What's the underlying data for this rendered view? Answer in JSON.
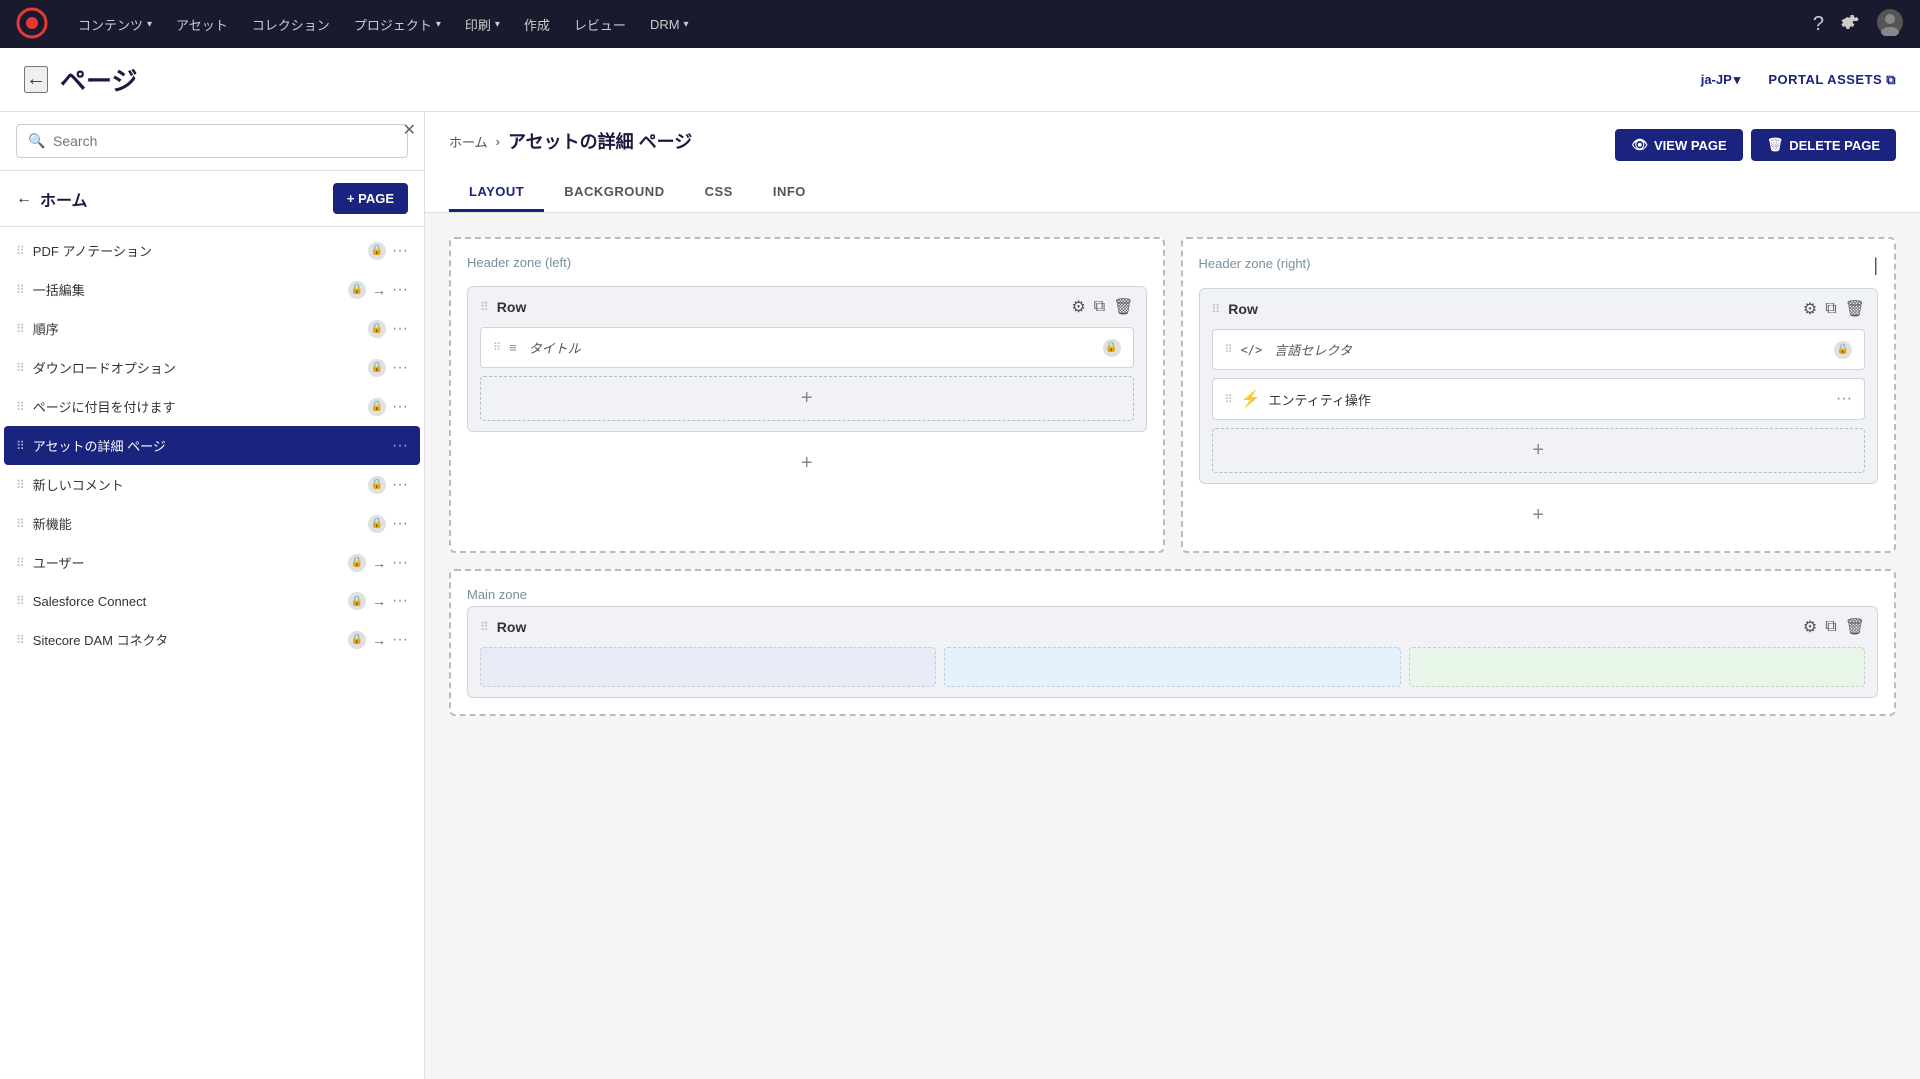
{
  "app": {
    "logo_color": "#e53935"
  },
  "topnav": {
    "items": [
      {
        "id": "contents",
        "label": "コンテンツ",
        "has_dropdown": true
      },
      {
        "id": "assets",
        "label": "アセット",
        "has_dropdown": false
      },
      {
        "id": "collections",
        "label": "コレクション",
        "has_dropdown": false
      },
      {
        "id": "projects",
        "label": "プロジェクト",
        "has_dropdown": true
      },
      {
        "id": "print",
        "label": "印刷",
        "has_dropdown": true
      },
      {
        "id": "create",
        "label": "作成",
        "has_dropdown": false
      },
      {
        "id": "review",
        "label": "レビュー",
        "has_dropdown": false
      },
      {
        "id": "drm",
        "label": "DRM",
        "has_dropdown": true
      }
    ]
  },
  "page_header": {
    "back_label": "←",
    "title": "ページ",
    "locale": "ja-JP",
    "locale_arrow": "▾",
    "portal_assets": "PORTAL ASSETS",
    "portal_icon": "⧉"
  },
  "sidebar": {
    "search_placeholder": "Search",
    "home_label": "ホーム",
    "add_page_label": "+ PAGE",
    "items": [
      {
        "id": "pdf-annotation",
        "label": "PDF アノテーション",
        "has_lock": true,
        "has_arrow": false
      },
      {
        "id": "bulk-edit",
        "label": "一括編集",
        "has_lock": true,
        "has_arrow": true
      },
      {
        "id": "order",
        "label": "順序",
        "has_lock": true,
        "has_arrow": false
      },
      {
        "id": "download-options",
        "label": "ダウンロードオプション",
        "has_lock": true,
        "has_arrow": false
      },
      {
        "id": "bookmarks",
        "label": "ページに付目を付けます",
        "has_lock": true,
        "has_arrow": false
      },
      {
        "id": "asset-detail",
        "label": "アセットの詳細 ページ",
        "has_lock": false,
        "has_arrow": false,
        "active": true
      },
      {
        "id": "new-comment",
        "label": "新しいコメント",
        "has_lock": true,
        "has_arrow": false
      },
      {
        "id": "new-features",
        "label": "新機能",
        "has_lock": true,
        "has_arrow": false
      },
      {
        "id": "users",
        "label": "ユーザー",
        "has_lock": true,
        "has_arrow": true
      },
      {
        "id": "salesforce-connect",
        "label": "Salesforce Connect",
        "has_lock": true,
        "has_arrow": true
      },
      {
        "id": "sitecore-dam",
        "label": "Sitecore DAM コネクタ",
        "has_lock": true,
        "has_arrow": true
      }
    ]
  },
  "content": {
    "breadcrumb_home": "ホーム",
    "breadcrumb_arrow": "›",
    "page_name": "アセットの詳細 ページ",
    "view_page_label": "VIEW PAGE",
    "delete_page_label": "DELETE PAGE",
    "tabs": [
      {
        "id": "layout",
        "label": "LAYOUT",
        "active": true
      },
      {
        "id": "background",
        "label": "BACKGROUND",
        "active": false
      },
      {
        "id": "css",
        "label": "CSS",
        "active": false
      },
      {
        "id": "info",
        "label": "INFO",
        "active": false
      }
    ],
    "zones": {
      "header_left": {
        "label": "Header zone (left)",
        "rows": [
          {
            "title": "Row",
            "components": [
              {
                "type": "title",
                "icon": "≡",
                "label": "タイトル",
                "has_lock": true
              }
            ]
          }
        ]
      },
      "header_right": {
        "label": "Header zone (right)",
        "rows": [
          {
            "title": "Row",
            "components": [
              {
                "type": "code",
                "icon": "</>",
                "label": "言語セレクタ",
                "has_lock": true
              },
              {
                "type": "entity",
                "icon": "⚡",
                "label": "エンティティ操作",
                "is_entity": true
              }
            ]
          }
        ]
      },
      "main": {
        "label": "Main zone",
        "rows": [
          {
            "title": "Row",
            "components": []
          }
        ]
      }
    }
  },
  "icons": {
    "search": "🔍",
    "gear": "⚙",
    "copy": "⧉",
    "trash": "🗑",
    "eye": "👁",
    "plus": "+",
    "back_arrow": "←",
    "lock": "🔒",
    "dots": "···",
    "drag_grid": "⠿",
    "lightning": "⚡",
    "chevron_down": "▾",
    "external_link": "⧉"
  }
}
